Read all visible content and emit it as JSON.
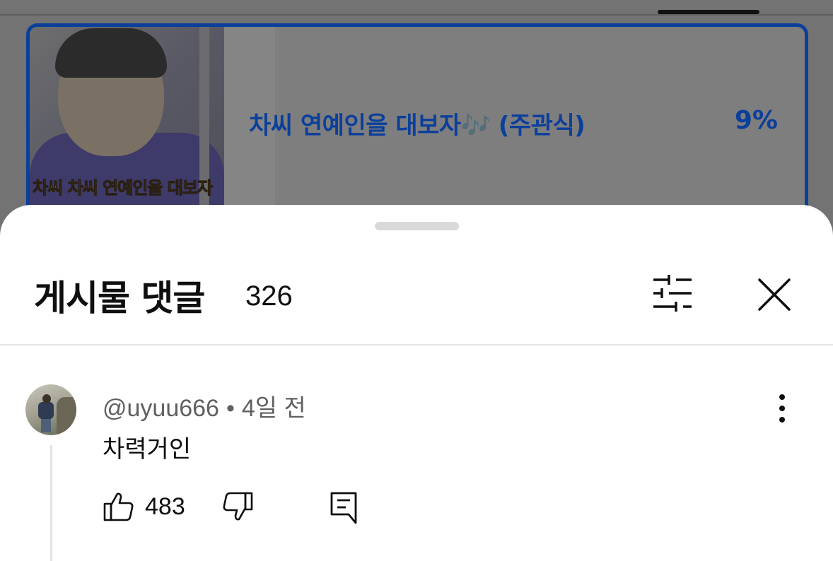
{
  "background": {
    "poll": {
      "thumbnail_caption": "차씨 차씨 연예인을 대보자",
      "option_text": "차씨 연예인을 대보자🎶 (주관식)",
      "percent": "9%",
      "accent_color": "#0b3f9c"
    }
  },
  "sheet": {
    "title": "게시물 댓글",
    "count": "326",
    "icons": {
      "filter": "filter-sliders-icon",
      "close": "close-icon"
    }
  },
  "comments": [
    {
      "author": "@uyuu666",
      "separator": "•",
      "time": "4일 전",
      "text": "차력거인",
      "likes": "483",
      "icons": {
        "like": "thumbs-up-icon",
        "dislike": "thumbs-down-icon",
        "reply": "reply-comment-icon",
        "more": "more-vertical-icon"
      }
    }
  ]
}
